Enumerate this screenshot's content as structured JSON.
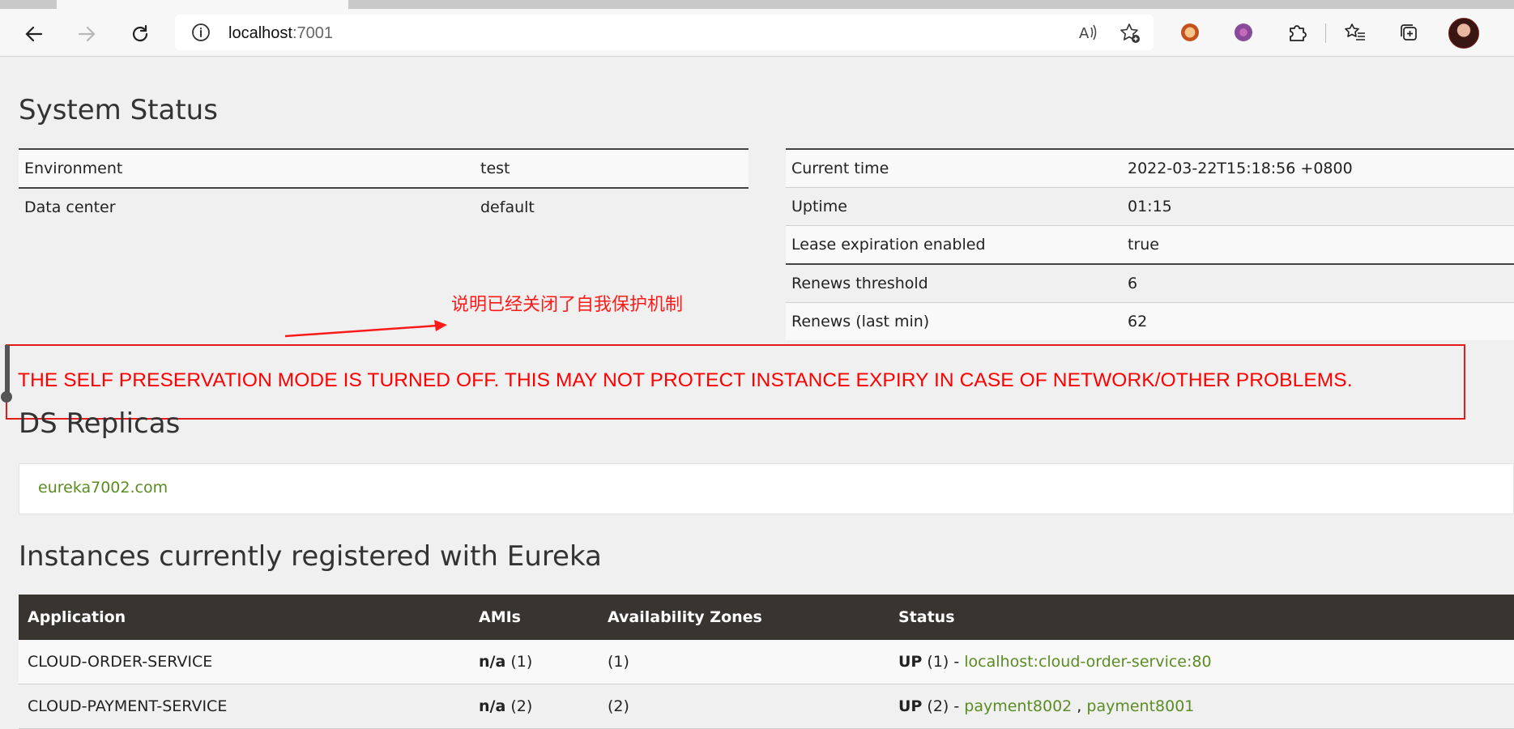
{
  "browser": {
    "url_host": "localhost",
    "url_port": ":7001",
    "icons": [
      "back-icon",
      "forward-icon",
      "refresh-icon",
      "info-icon",
      "read-aloud-icon",
      "add-favorite-icon",
      "extension-icon",
      "extension-icon",
      "puzzle-icon",
      "favorites-icon",
      "collections-icon",
      "profile-avatar"
    ]
  },
  "system_status": {
    "title": "System Status",
    "left_rows": [
      {
        "label": "Environment",
        "value": "test"
      },
      {
        "label": "Data center",
        "value": "default"
      }
    ],
    "right_rows": [
      {
        "label": "Current time",
        "value": "2022-03-22T15:18:56 +0800"
      },
      {
        "label": "Uptime",
        "value": "01:15"
      },
      {
        "label": "Lease expiration enabled",
        "value": "true"
      },
      {
        "label": "Renews threshold",
        "value": "6"
      },
      {
        "label": "Renews (last min)",
        "value": "62"
      }
    ]
  },
  "annotation": {
    "text": "说明已经关闭了自我保护机制",
    "color": "#ff1a1a"
  },
  "warning": {
    "text": "THE SELF PRESERVATION MODE IS TURNED OFF. THIS MAY NOT PROTECT INSTANCE EXPIRY IN CASE OF NETWORK/OTHER PROBLEMS.",
    "color": "#ff0000"
  },
  "replicas": {
    "title": "DS Replicas",
    "link": "eureka7002.com"
  },
  "instances": {
    "title": "Instances currently registered with Eureka",
    "headers": [
      "Application",
      "AMIs",
      "Availability Zones",
      "Status"
    ],
    "rows": [
      {
        "app": "CLOUD-ORDER-SERVICE",
        "ami": "n/a",
        "ami_count": "(1)",
        "zones": "(1)",
        "status": "UP",
        "status_count": "(1) -",
        "links": [
          "localhost:cloud-order-service:80"
        ]
      },
      {
        "app": "CLOUD-PAYMENT-SERVICE",
        "ami": "n/a",
        "ami_count": "(2)",
        "zones": "(2)",
        "status": "UP",
        "status_count": "(2) -",
        "links": [
          "payment8002",
          "payment8001"
        ],
        "link_sep": " , "
      }
    ]
  },
  "colors": {
    "accent_link": "#5a8c22",
    "header_bg": "#38342f",
    "warning_red": "#ff0000"
  }
}
